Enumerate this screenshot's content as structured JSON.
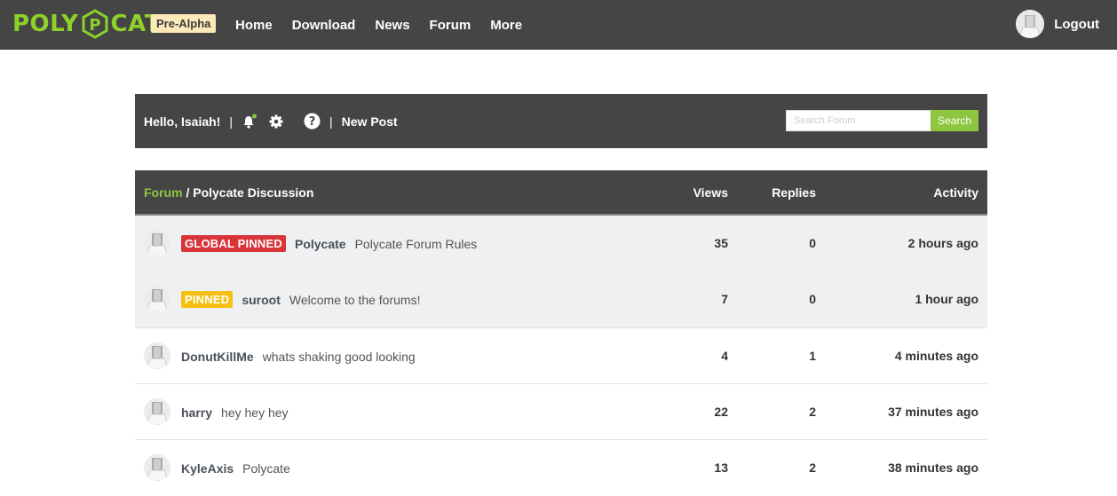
{
  "brand": {
    "logo_left": "POLY",
    "logo_mark": "P",
    "logo_right": "CATE",
    "badge": "Pre-Alpha",
    "accent": "#8dd12a"
  },
  "nav": {
    "links": [
      "Home",
      "Download",
      "News",
      "Forum",
      "More"
    ],
    "logout": "Logout"
  },
  "toolbar": {
    "greeting": "Hello, Isaiah!",
    "separator": "|",
    "new_post": "New Post",
    "search_placeholder": "Search Forum",
    "search_button": "Search",
    "icons": [
      "bell-icon",
      "gear-icon",
      "help-icon"
    ]
  },
  "table": {
    "breadcrumb_root": "Forum",
    "breadcrumb_sep": " / ",
    "breadcrumb_current": "Polycate Discussion",
    "col_views": "Views",
    "col_replies": "Replies",
    "col_activity": "Activity",
    "rows": [
      {
        "tag": "GLOBAL PINNED",
        "tag_color": "#d9343a",
        "author": "Polycate",
        "title": "Polycate Forum Rules",
        "views": "35",
        "replies": "0",
        "activity": "2 hours ago"
      },
      {
        "tag": "PINNED",
        "tag_color": "#f7c010",
        "author": "suroot",
        "title": "Welcome to the forums!",
        "views": "7",
        "replies": "0",
        "activity": "1 hour ago"
      },
      {
        "tag": "",
        "author": "DonutKillMe",
        "title": "whats shaking good looking",
        "views": "4",
        "replies": "1",
        "activity": "4 minutes ago"
      },
      {
        "tag": "",
        "author": "harry",
        "title": "hey hey hey",
        "views": "22",
        "replies": "2",
        "activity": "37 minutes ago"
      },
      {
        "tag": "",
        "author": "KyleAxis",
        "title": "Polycate",
        "views": "13",
        "replies": "2",
        "activity": "38 minutes ago"
      }
    ]
  }
}
